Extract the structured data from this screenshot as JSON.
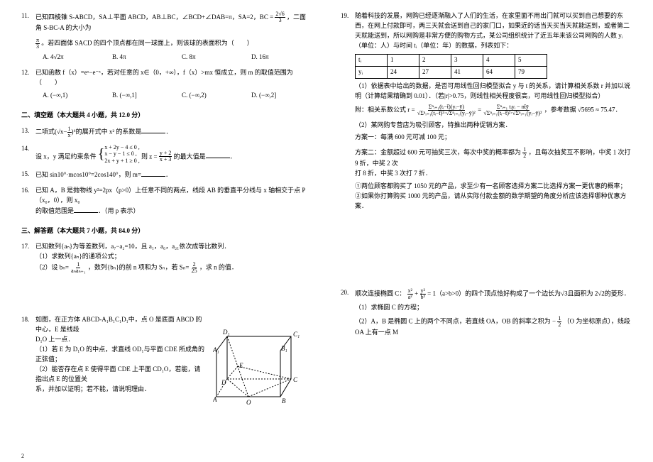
{
  "page_number": "2",
  "left": {
    "q11": {
      "num": "11.",
      "text_a": "已知四棱锥 S-ABCD，SA⊥平面 ABCD，AB⊥BC，∠BCD+∠DAB=π，SA=2，BC = ",
      "frac_n": "2√6",
      "frac_d": "3",
      "text_b": "，二面角 S-BC-A 的大小为",
      "text_c": "。若四面体 SACD 的四个顶点都在同一球面上，则该球的表面积为（　　）",
      "pi3_n": "π",
      "pi3_d": "3",
      "opts": [
        "A. 4√2π",
        "B. 4π",
        "C. 8π",
        "D. 16π"
      ]
    },
    "q12": {
      "num": "12.",
      "text": "已知函数 f（x）=eˣ−e⁻ˣ，若对任意的 x∈（0，+∞），f（x）>mx 恒成立，则 m 的取值范围为（　　）",
      "opts": [
        "A. (−∞,1)",
        "B. (−∞,1]",
        "C. (−∞,2)",
        "D. (−∞,2]"
      ]
    },
    "sec2": "二、填空题（本大题共 4 小题，共 12.0 分）",
    "q13": {
      "num": "13.",
      "text_a": "二项式(√x−",
      "frac_n": "1",
      "frac_d": "x",
      "text_b": ")⁶的展开式中 x² 的系数是",
      "tail": "．"
    },
    "q14": {
      "num": "14.",
      "text_a": "设 x，y 满足约束条件",
      "sys": [
        "x + 2y − 4 ≤ 0 ,",
        "x − y − 1 ≤ 0 ,",
        "2x + y + 1 ≥ 0 ,"
      ],
      "text_b": "则 z = ",
      "frac_n": "y + 2",
      "frac_d": "x + 3",
      "text_c": " 的最大值是",
      "tail": "．"
    },
    "q15": {
      "num": "15.",
      "text": "已知 sin10°·mcos10°=2cos140°，则 m=",
      "tail": "．"
    },
    "q16": {
      "num": "16.",
      "text_a": "已知 A，B 是抛物线 y²=2px（p>0）上任意不同的两点，线段 AB 的垂直平分线与 x 轴相交于点 P（x₀，0），则 x₀",
      "text_b": "的取值范围是",
      "text_c": "．（用 p 表示）"
    },
    "sec3": "三、解答题（本大题共 7 小题，共 84.0 分）",
    "q17": {
      "num": "17.",
      "line1": "已知数列{aₙ}为等差数列，a₇−a₂=10，且 a₁，a₆，a₂₁依次成等比数列．",
      "sub1": "（1）求数列{aₙ}的通项公式；",
      "sub2_a": "（2）设 bₙ=",
      "frac_n": "1",
      "frac_d": "aₙaₙ₊₁",
      "sub2_b": "，数列{bₙ}的前 n 项和为 Sₙ，若 Sₙ=",
      "frac2_n": "2",
      "frac2_d": "25",
      "sub2_c": "，求 n 的值．"
    },
    "q18": {
      "num": "18.",
      "line1": "如图，在正方体 ABCD-A₁B₁C₁D₁中，点 O 是底面 ABCD 的中心，E 是线段",
      "line2": "D₁O 上一点．",
      "sub1": "（1）若 E 为 D₁O 的中点，求直线 OD₁与平面 CDE 所成角的正弦值；",
      "sub2": "（2）能否存在点 E 使得平面 CDE 上平面 CD₁O，若能，请指出点 E 的位置关",
      "sub3": "系，并加以证明；若不能，请说明理由．",
      "labels": {
        "A": "A",
        "B": "B",
        "C": "C",
        "D": "D",
        "A1": "A₁",
        "B1": "B₁",
        "C1": "C₁",
        "D1": "D₁",
        "O": "O",
        "E": "E"
      }
    }
  },
  "right": {
    "q19": {
      "num": "19.",
      "p1": "随着科技的发展，网购已经逐渐融入了人们的生活，在家里面不用出门就可以买到自己想要的东西，在网上付款即可，两三天就会送到自己的家门口，如果近的话当天买当天就能送到，或者第二天就能送到，所以网购是非常方便的购物方式，某公司组织统计了近五年来该公司网购的人数 yᵢ（单位：人）与时间 tᵢ（单位：年）的数据，列表如下：",
      "table": {
        "head": [
          "tᵢ",
          "1",
          "2",
          "3",
          "4",
          "5"
        ],
        "row": [
          "yᵢ",
          "24",
          "27",
          "41",
          "64",
          "79"
        ]
      },
      "p2": "（1）依据表中给出的数据，是否可用线性回归模型拟合 y 与 t 的关系，请计算相关系数 r 并加以说明（计算结果精确到 0.01）．（若|r|>0.75，则线性相关程度很高，可用线性回归模型拟合）",
      "hint_a": "附：相关系数公式 r = ",
      "frac1_n": "Σⁿᵢ₌₁(tᵢ−t̄)(yᵢ−ȳ)",
      "frac1_d": "√Σⁿᵢ₌₁(tᵢ−t̄)²·√Σⁿᵢ₌₁(yᵢ−ȳ)²",
      "hint_b": " = ",
      "frac2_n": "Σⁿᵢ₌₁ tᵢyᵢ − nt̄ȳ",
      "frac2_d": "√Σⁿᵢ₌₁(tᵢ−t̄)²·√Σⁿᵢ₌₁(yᵢ−ȳ)²",
      "hint_c": "，参考数据 √5695 ≈ 75.47．",
      "p3": "（2）某网购专营店为吸引顾客，特推出两种促销方案．",
      "plan1": "方案一：每满 600 元可减 100 元；",
      "plan2_a": "方案二：金额超过 600 元可抽奖三次，每次中奖的概率都为",
      "plan2_frac_n": "1",
      "plan2_frac_d": "2",
      "plan2_b": "，且每次抽奖互不影响，中奖 1 次打 9 折，中奖 2 次",
      "plan2_c": "打 8 折，中奖 3 次打 7 折．",
      "q_a": "①两位顾客都购买了 1050 元的产品，求至少有一名顾客选择方案二比选择方案一更优惠的概率；",
      "q_b": "②如果你打算购买 1000 元的产品，请从实际付款金额的数学期望的角度分析应该选择哪种优惠方案．"
    },
    "q20": {
      "num": "20.",
      "text_a": "顺次连接椭圆 C：",
      "frac1_n": "x²",
      "frac1_d": "a²",
      "plus": " + ",
      "frac2_n": "y²",
      "frac2_d": "b²",
      "text_b": " = 1（a>b>0）的四个顶点恰好构成了一个边长为√3且面积为 2√2的菱形．",
      "sub1": "（1）求椭圆 C 的方程；",
      "sub2_a": "（2）A，B 是椭圆 C 上的两个不同点，若直线 OA，OB 的斜率之积为 −",
      "frac3_n": "1",
      "frac3_d": "2",
      "sub2_b": "（O 为坐标原点），线段 OA 上有一点 M"
    }
  }
}
